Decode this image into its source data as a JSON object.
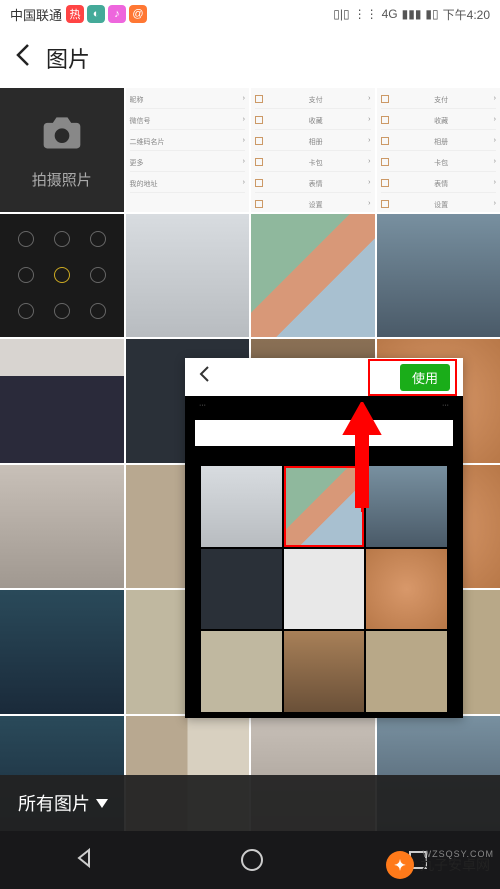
{
  "status": {
    "carrier": "中国联通",
    "time": "下午4:20",
    "signal": "4G"
  },
  "header": {
    "title": "图片"
  },
  "camera": {
    "label": "拍摄照片"
  },
  "settings_rows": [
    "昵称",
    "微信号",
    "二维码名片",
    "更多",
    "我的地址"
  ],
  "settings_rows2": [
    "支付",
    "收藏",
    "相册",
    "卡包",
    "表情",
    "设置"
  ],
  "popup": {
    "use_label": "使用"
  },
  "bottom": {
    "all_images": "所有图片"
  },
  "watermark": {
    "brand": "丸子安卓网",
    "url": "WZSQSY.COM"
  },
  "chart_data": null
}
